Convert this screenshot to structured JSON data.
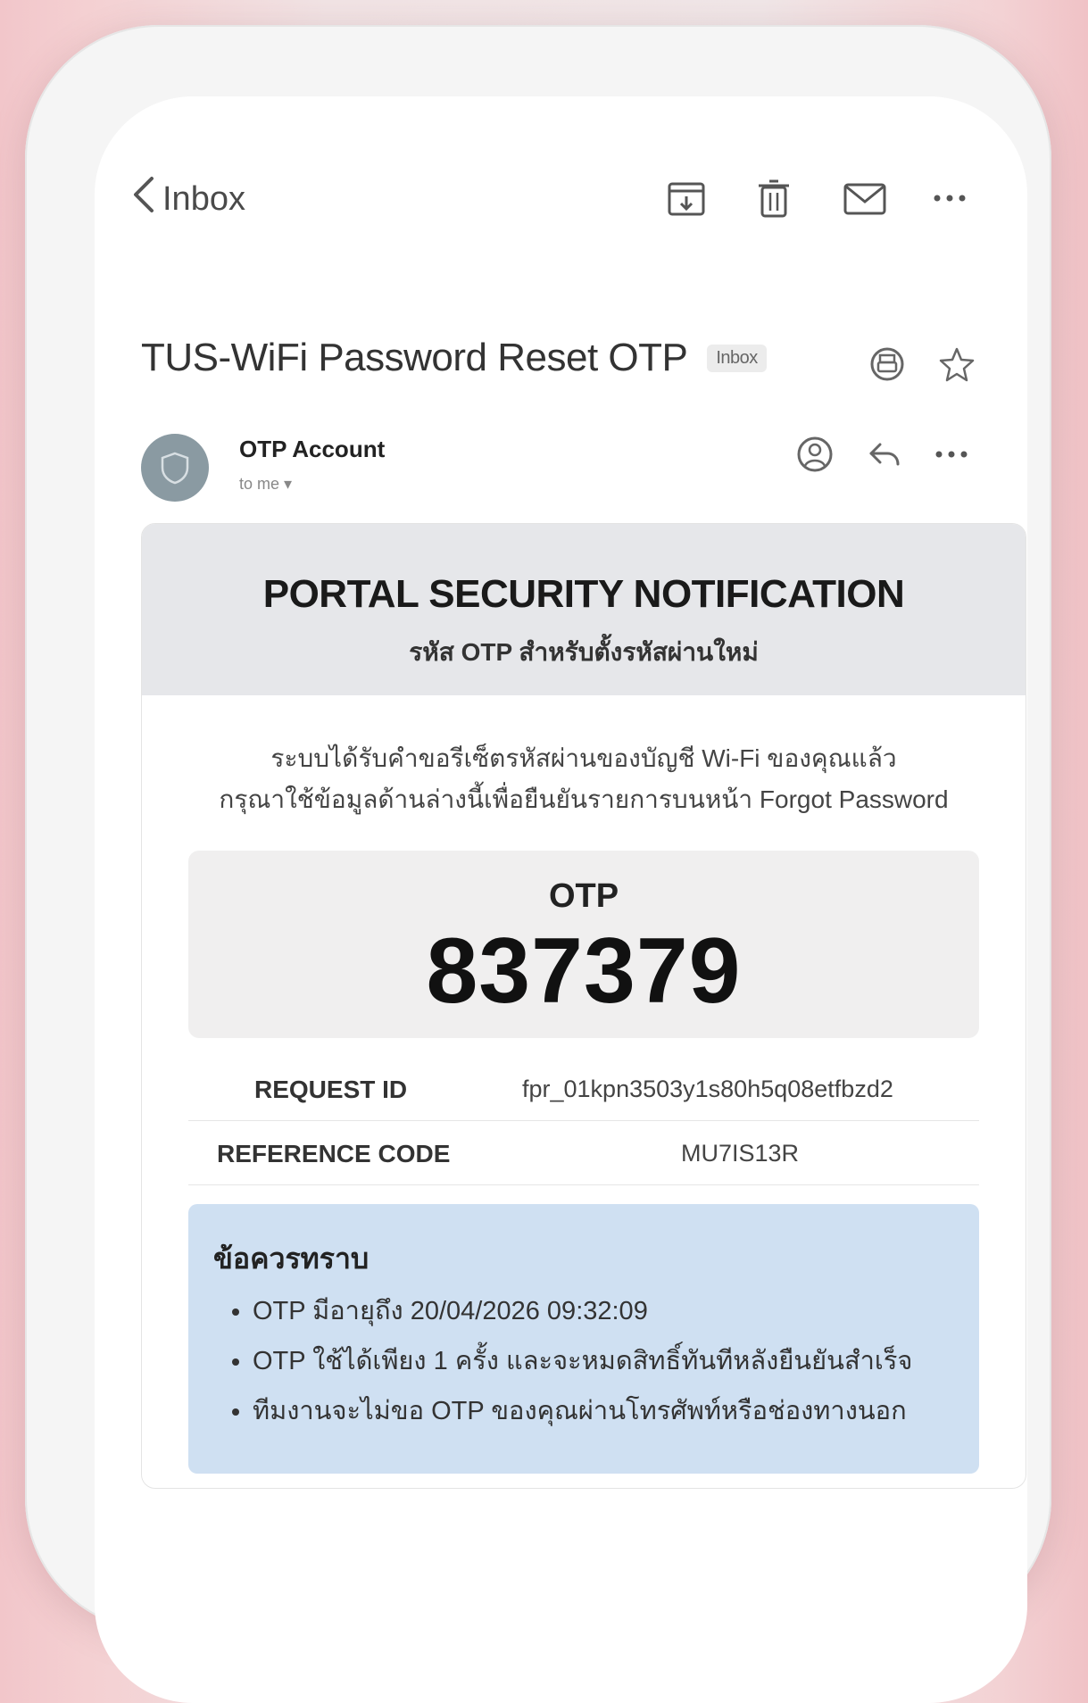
{
  "toolbar": {
    "back_label": "Inbox",
    "icons": [
      "archive-icon",
      "trash-icon",
      "mail-icon",
      "more-icon"
    ]
  },
  "email": {
    "subject": "TUS-WiFi Password Reset OTP",
    "folder_badge": "Inbox",
    "sender_name": "OTP Account",
    "sender_sub": "to me ▾"
  },
  "card": {
    "title": "PORTAL SECURITY NOTIFICATION",
    "subtitle": "รหัส OTP สำหรับตั้งรหัสผ่านใหม่",
    "intro_line1": "ระบบได้รับคำขอรีเซ็ตรหัสผ่านของบัญชี Wi-Fi ของคุณแล้ว",
    "intro_line2": "กรุณาใช้ข้อมูลด้านล่างนี้เพื่อยืนยันรายการบนหน้า Forgot Password",
    "otp_label": "OTP",
    "otp_code": "837379",
    "request_id_label": "REQUEST ID",
    "request_id_value": "fpr_01kpn3503y1s80h5q08etfbzd2",
    "reference_label": "REFERENCE CODE",
    "reference_value": "MU7IS13R"
  },
  "notice": {
    "title": "ข้อควรทราบ",
    "items": [
      "OTP มีอายุถึง 20/04/2026 09:32:09",
      "OTP ใช้ได้เพียง 1 ครั้ง และจะหมดสิทธิ์ทันทีหลังยืนยันสำเร็จ",
      "ทีมงานจะไม่ขอ OTP ของคุณผ่านโทรศัพท์หรือช่องทางนอก"
    ]
  }
}
